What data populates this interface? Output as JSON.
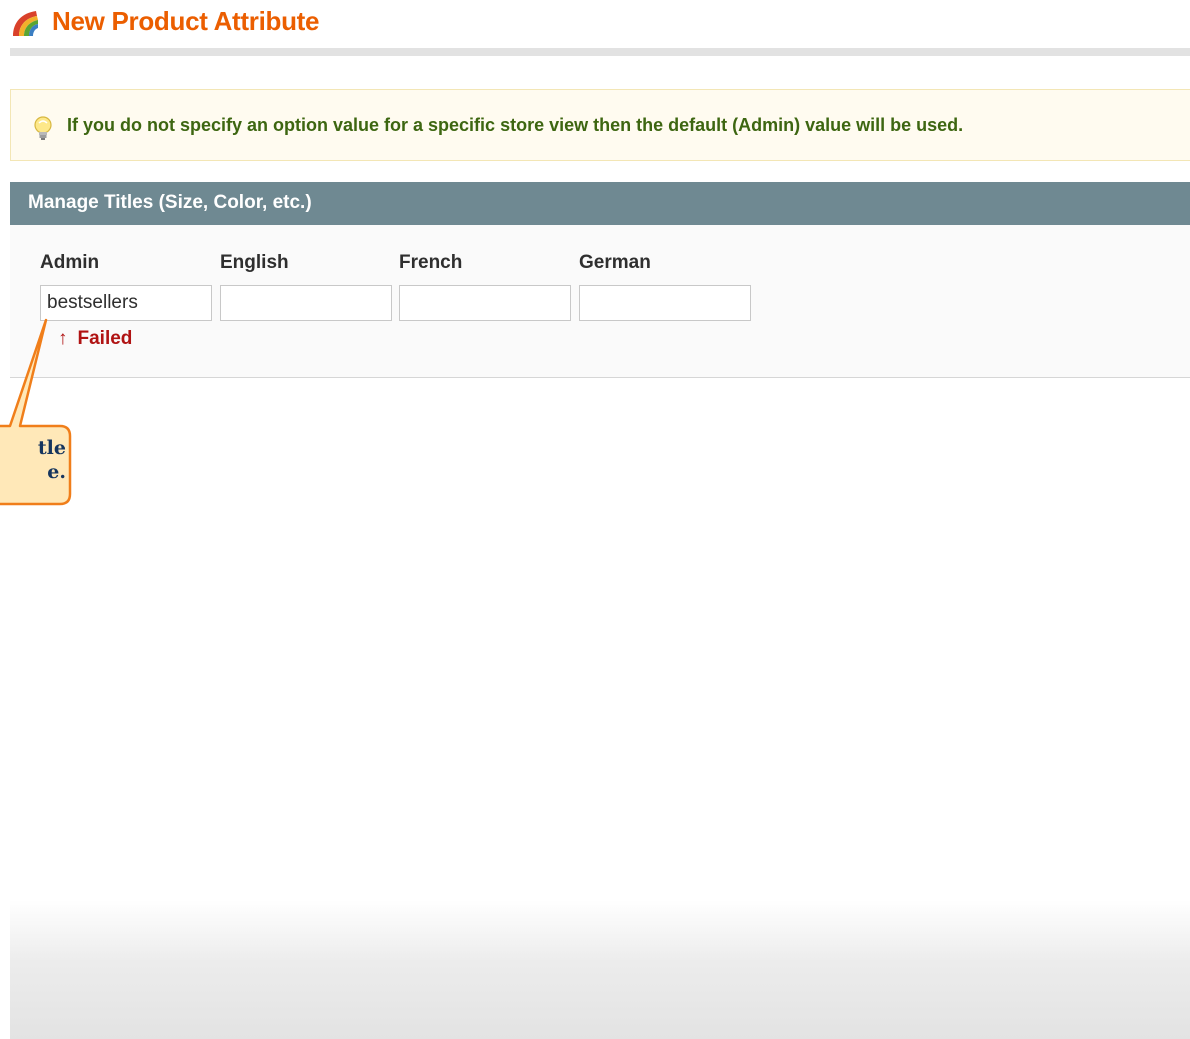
{
  "header": {
    "title": "New Product Attribute",
    "icon": "rainbow-icon",
    "title_color": "#eb5e00"
  },
  "notice": {
    "icon": "lightbulb-icon",
    "text": "If you do not specify an option value for a specific store view then the default (Admin) value will be used.",
    "text_color": "#3d6611"
  },
  "manage_titles": {
    "title": "Manage Titles (Size, Color, etc.)",
    "header_color": "#6f8992",
    "columns": [
      {
        "label": "Admin",
        "value": "bestsellers"
      },
      {
        "label": "English",
        "value": ""
      },
      {
        "label": "French",
        "value": ""
      },
      {
        "label": "German",
        "value": ""
      }
    ],
    "validation": {
      "icon": "arrow-up-icon",
      "arrow": "↑",
      "text": "Failed",
      "color": "#b01313"
    }
  },
  "callout": {
    "text": "tle\ne.",
    "border_color": "#f07e1a",
    "fill_color": "#ffe8b8"
  }
}
